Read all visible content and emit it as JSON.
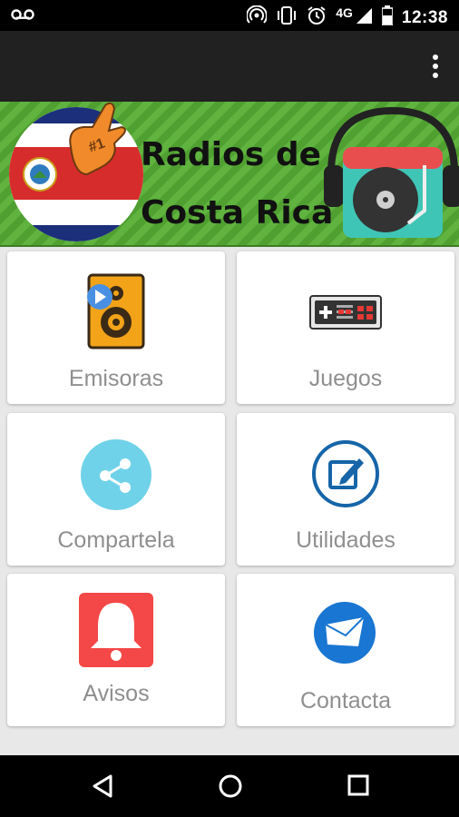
{
  "status_bar": {
    "time": "12:38",
    "network": "4G"
  },
  "banner": {
    "title_line1": "Radios de",
    "title_line2": "Costa Rica",
    "badge": "#1"
  },
  "menu": {
    "emisoras": "Emisoras",
    "juegos": "Juegos",
    "compartela": "Compartela",
    "utilidades": "Utilidades",
    "avisos": "Avisos",
    "contacta": "Contacta"
  },
  "colors": {
    "banner_green": "#5fb33e",
    "app_bar": "#212121",
    "share_bg": "#6fd2e8",
    "alert_red": "#f44747",
    "mail_blue": "#1976d2"
  }
}
